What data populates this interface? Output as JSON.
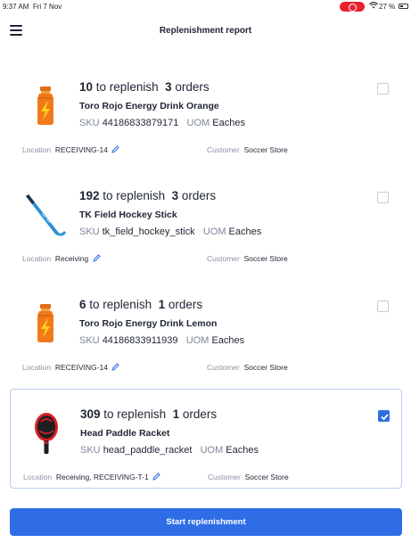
{
  "status_bar": {
    "time": "9:37 AM",
    "date": "Fri 7 Nov",
    "battery": "27 %"
  },
  "header": {
    "title": "Replenishment report"
  },
  "items": [
    {
      "qty": "10",
      "qty_label": "to replenish",
      "orders": "3",
      "orders_label": "orders",
      "name": "Toro Rojo Energy Drink Orange",
      "sku_label": "SKU",
      "sku": "44186833879171",
      "uom_label": "UOM",
      "uom": "Eaches",
      "location_label": "Location",
      "location": "RECEIVING-14",
      "customer_label": "Customer",
      "customer": "Soccer Store",
      "icon": "energy-drink-bottle-icon",
      "checked": false
    },
    {
      "qty": "192",
      "qty_label": "to replenish",
      "orders": "3",
      "orders_label": "orders",
      "name": "TK Field Hockey Stick",
      "sku_label": "SKU",
      "sku": "tk_field_hockey_stick",
      "uom_label": "UOM",
      "uom": "Eaches",
      "location_label": "Location",
      "location": "Receiving",
      "customer_label": "Customer",
      "customer": "Soccer Store",
      "icon": "hockey-stick-icon",
      "checked": false
    },
    {
      "qty": "6",
      "qty_label": "to replenish",
      "orders": "1",
      "orders_label": "orders",
      "name": "Toro Rojo Energy Drink Lemon",
      "sku_label": "SKU",
      "sku": "44186833911939",
      "uom_label": "UOM",
      "uom": "Eaches",
      "location_label": "Location",
      "location": "RECEIVING-14",
      "customer_label": "Customer",
      "customer": "Soccer Store",
      "icon": "energy-drink-bottle-icon",
      "checked": false
    },
    {
      "qty": "309",
      "qty_label": "to replenish",
      "orders": "1",
      "orders_label": "orders",
      "name": "Head Paddle Racket",
      "sku_label": "SKU",
      "sku": "head_paddle_racket",
      "uom_label": "UOM",
      "uom": "Eaches",
      "location_label": "Location",
      "location": "Receiving, RECEIVING-T-1",
      "customer_label": "Customer",
      "customer": "Soccer Store",
      "icon": "paddle-racket-icon",
      "checked": true
    }
  ],
  "actions": {
    "start_label": "Start replenishment"
  },
  "colors": {
    "accent": "#2f6de6",
    "selected_border": "#b7cff2",
    "muted_text": "#7c8596"
  }
}
